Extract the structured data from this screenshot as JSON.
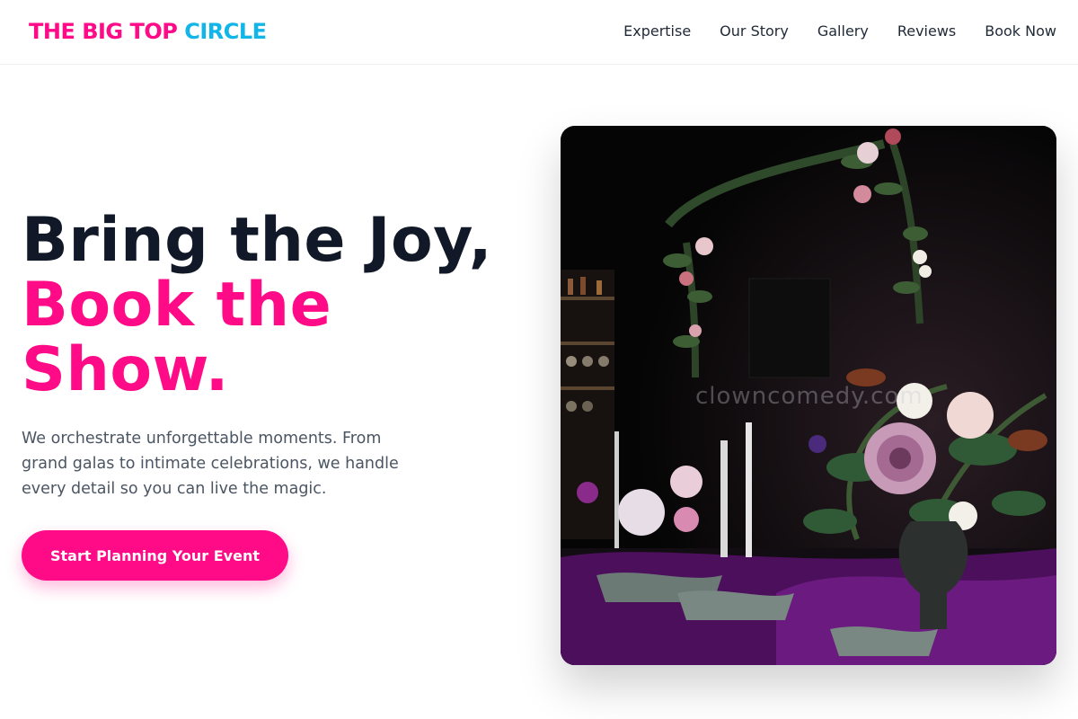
{
  "brand": {
    "part1": "THE BIG TOP",
    "part2": "CIRCLE",
    "color_primary": "#ff0a87",
    "color_secondary": "#12b5e8"
  },
  "nav": {
    "items": [
      "Expertise",
      "Our Story",
      "Gallery",
      "Reviews",
      "Book Now"
    ]
  },
  "hero": {
    "heading_line1": "Bring the Joy,",
    "heading_line2": "Book the Show.",
    "description": "We orchestrate unforgettable moments. From grand galas to intimate celebrations, we handle every detail so you can live the magic.",
    "cta_label": "Start Planning Your Event",
    "accent_color": "#ff0a87"
  },
  "image": {
    "watermark": "clowncomedy.com"
  }
}
